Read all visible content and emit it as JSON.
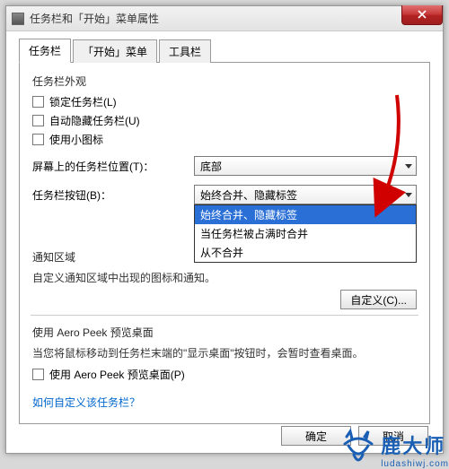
{
  "title": "任务栏和「开始」菜单属性",
  "tabs": {
    "taskbar": "任务栏",
    "startmenu": "「开始」菜单",
    "toolbars": "工具栏"
  },
  "appearance": {
    "heading": "任务栏外观",
    "lock": "锁定任务栏(L)",
    "autohide": "自动隐藏任务栏(U)",
    "smallicons": "使用小图标"
  },
  "position": {
    "label": "屏幕上的任务栏位置(T)：",
    "value": "底部"
  },
  "buttons": {
    "label": "任务栏按钮(B)：",
    "value": "始终合并、隐藏标签",
    "options": [
      "始终合并、隐藏标签",
      "当任务栏被占满时合并",
      "从不合并"
    ]
  },
  "notify": {
    "heading": "通知区域",
    "desc": "自定义通知区域中出现的图标和通知。",
    "customize": "自定义(C)..."
  },
  "aero": {
    "heading": "使用 Aero Peek 预览桌面",
    "desc": "当您将鼠标移动到任务栏末端的\"显示桌面\"按钮时，会暂时查看桌面。",
    "checkbox": "使用 Aero Peek 预览桌面(P)"
  },
  "link": "如何自定义该任务栏？",
  "actions": {
    "ok": "确定",
    "cancel": "取消"
  },
  "watermark": {
    "main": "鹿大师",
    "sub": "ludashiwj.com"
  }
}
